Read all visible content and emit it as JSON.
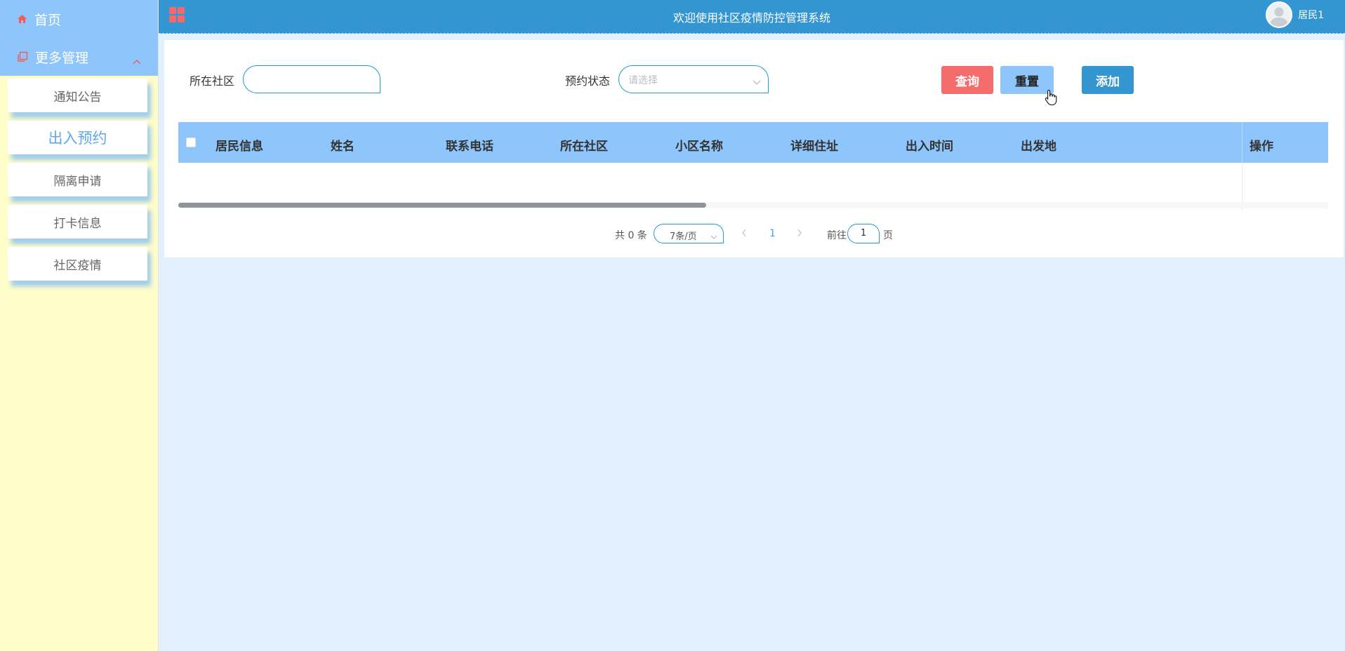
{
  "header": {
    "title": "欢迎使用社区疫情防控管理系统",
    "username": "居民1"
  },
  "sidebar": {
    "home_label": "首页",
    "more_label": "更多管理",
    "items": [
      {
        "label": "通知公告",
        "active": false
      },
      {
        "label": "出入预约",
        "active": true
      },
      {
        "label": "隔离申请",
        "active": false
      },
      {
        "label": "打卡信息",
        "active": false
      },
      {
        "label": "社区疫情",
        "active": false
      }
    ]
  },
  "search": {
    "community_label": "所在社区",
    "community_value": "",
    "status_label": "预约状态",
    "status_placeholder": "请选择"
  },
  "buttons": {
    "query": "查询",
    "reset": "重置",
    "add": "添加"
  },
  "table": {
    "columns": [
      "居民信息",
      "姓名",
      "联系电话",
      "所在社区",
      "小区名称",
      "详细住址",
      "出入时间",
      "出发地"
    ],
    "op_column": "操作",
    "rows": []
  },
  "pagination": {
    "total_text": "共 0 条",
    "page_size": "7条/页",
    "current_page": "1",
    "goto_prefix": "前往",
    "goto_value": "1",
    "goto_suffix": "页"
  },
  "colors": {
    "header_bg": "#3496d1",
    "sidebar_bg": "#fffdc9",
    "menu_head_bg": "#8ec5fb",
    "query_btn": "#f56c6c",
    "reset_btn": "#8ec5fb",
    "add_btn": "#3496d1",
    "content_bg": "#e2effc"
  },
  "icons": [
    "home-icon",
    "copy-icon",
    "chevron-up-icon",
    "grid-icon",
    "avatar-icon",
    "chevron-down-icon",
    "chevron-left-icon",
    "chevron-right-icon",
    "pointer-cursor-icon"
  ]
}
